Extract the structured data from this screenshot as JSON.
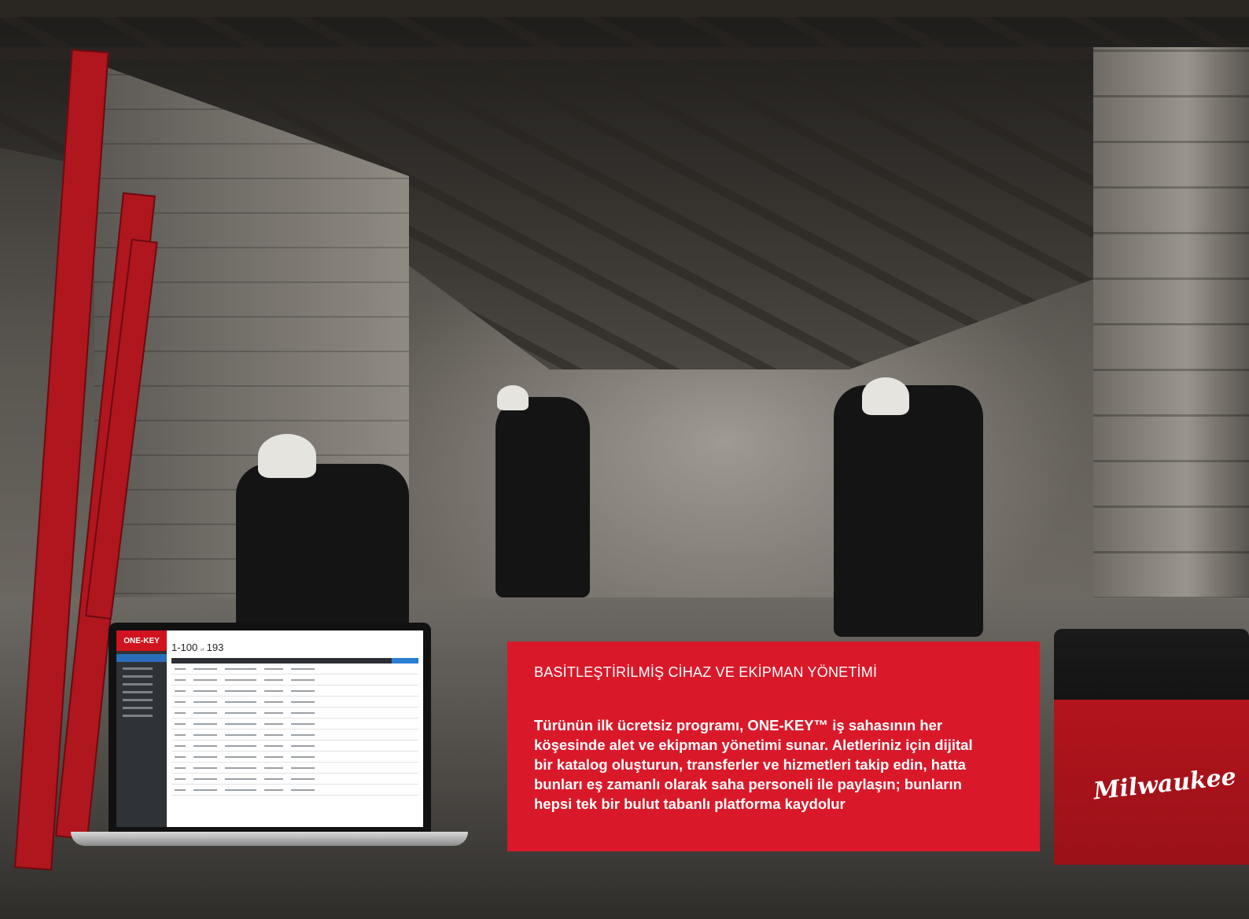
{
  "callout": {
    "heading": "BASİTLEŞTİRİLMİŞ CİHAZ VE EKİPMAN YÖNETİMİ",
    "body": "Türünün ilk ücretsiz programı, ONE-KEY™ iş sahasının her köşesinde alet ve ekipman yönetimi sunar. Aletleriniz için dijital bir katalog oluşturun, transferler ve hizmetleri takip edin, hatta bunları eş zamanlı olarak saha personeli ile paylaşın; bunların hepsi tek bir bulut tabanlı platforma kaydolur",
    "background": "#d9192a"
  },
  "laptop_screen": {
    "logo": "ONE-KEY",
    "count": "1-100",
    "count_total": "193"
  },
  "toolbag": {
    "brand": "Milwaukee"
  },
  "icons": [
    "laptop-icon"
  ]
}
